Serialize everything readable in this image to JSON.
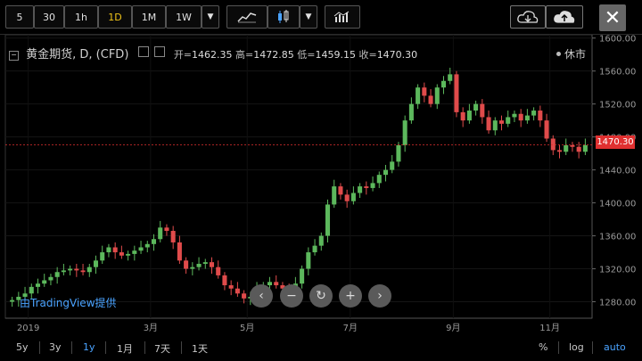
{
  "toolbar": {
    "intervals": [
      "5",
      "30",
      "1h",
      "1D",
      "1M",
      "1W"
    ],
    "active_interval": "1D",
    "close_label": "✕"
  },
  "header": {
    "symbol": "黄金期货, D, (CFD)",
    "open_label": "开=",
    "open": "1462.35",
    "high_label": "高=",
    "high": "1472.85",
    "low_label": "低=",
    "low": "1459.15",
    "close_label": "收=",
    "close": "1470.30",
    "status": "休市"
  },
  "price_tag": "1470.30",
  "attribution": "由TradingView提供",
  "ranges": [
    "5y",
    "3y",
    "1y",
    "1月",
    "7天",
    "1天"
  ],
  "active_range": "1y",
  "axis_modes": [
    "%",
    "log",
    "auto"
  ],
  "active_axis_mode": "auto",
  "colors": {
    "up": "#5cb85c",
    "down": "#e04b4b",
    "accent": "#4aa3ff",
    "active_interval": "#f0c419",
    "price_tag": "#e03030"
  },
  "chart_data": {
    "type": "candlestick",
    "y_ticks": [
      "1600.00",
      "1560.00",
      "1520.00",
      "1480.00",
      "1440.00",
      "1400.00",
      "1360.00",
      "1320.00",
      "1280.00"
    ],
    "y_range": [
      1260,
      1604
    ],
    "x_ticks": [
      "2019",
      "3月",
      "5月",
      "7月",
      "9月",
      "11月"
    ],
    "last_price": 1470.3,
    "closes_approx": [
      1282,
      1286,
      1290,
      1298,
      1302,
      1306,
      1310,
      1316,
      1318,
      1320,
      1318,
      1316,
      1322,
      1330,
      1340,
      1346,
      1340,
      1336,
      1338,
      1342,
      1346,
      1350,
      1356,
      1370,
      1366,
      1352,
      1330,
      1320,
      1322,
      1326,
      1328,
      1322,
      1312,
      1300,
      1296,
      1290,
      1284,
      1286,
      1296,
      1300,
      1304,
      1300,
      1296,
      1292,
      1302,
      1320,
      1340,
      1348,
      1360,
      1398,
      1420,
      1410,
      1402,
      1412,
      1420,
      1418,
      1424,
      1434,
      1440,
      1450,
      1470,
      1500,
      1520,
      1540,
      1530,
      1520,
      1540,
      1548,
      1556,
      1510,
      1500,
      1512,
      1520,
      1504,
      1488,
      1500,
      1496,
      1504,
      1508,
      1500,
      1506,
      1512,
      1500,
      1478,
      1464,
      1462,
      1470,
      1468,
      1462,
      1470
    ]
  }
}
